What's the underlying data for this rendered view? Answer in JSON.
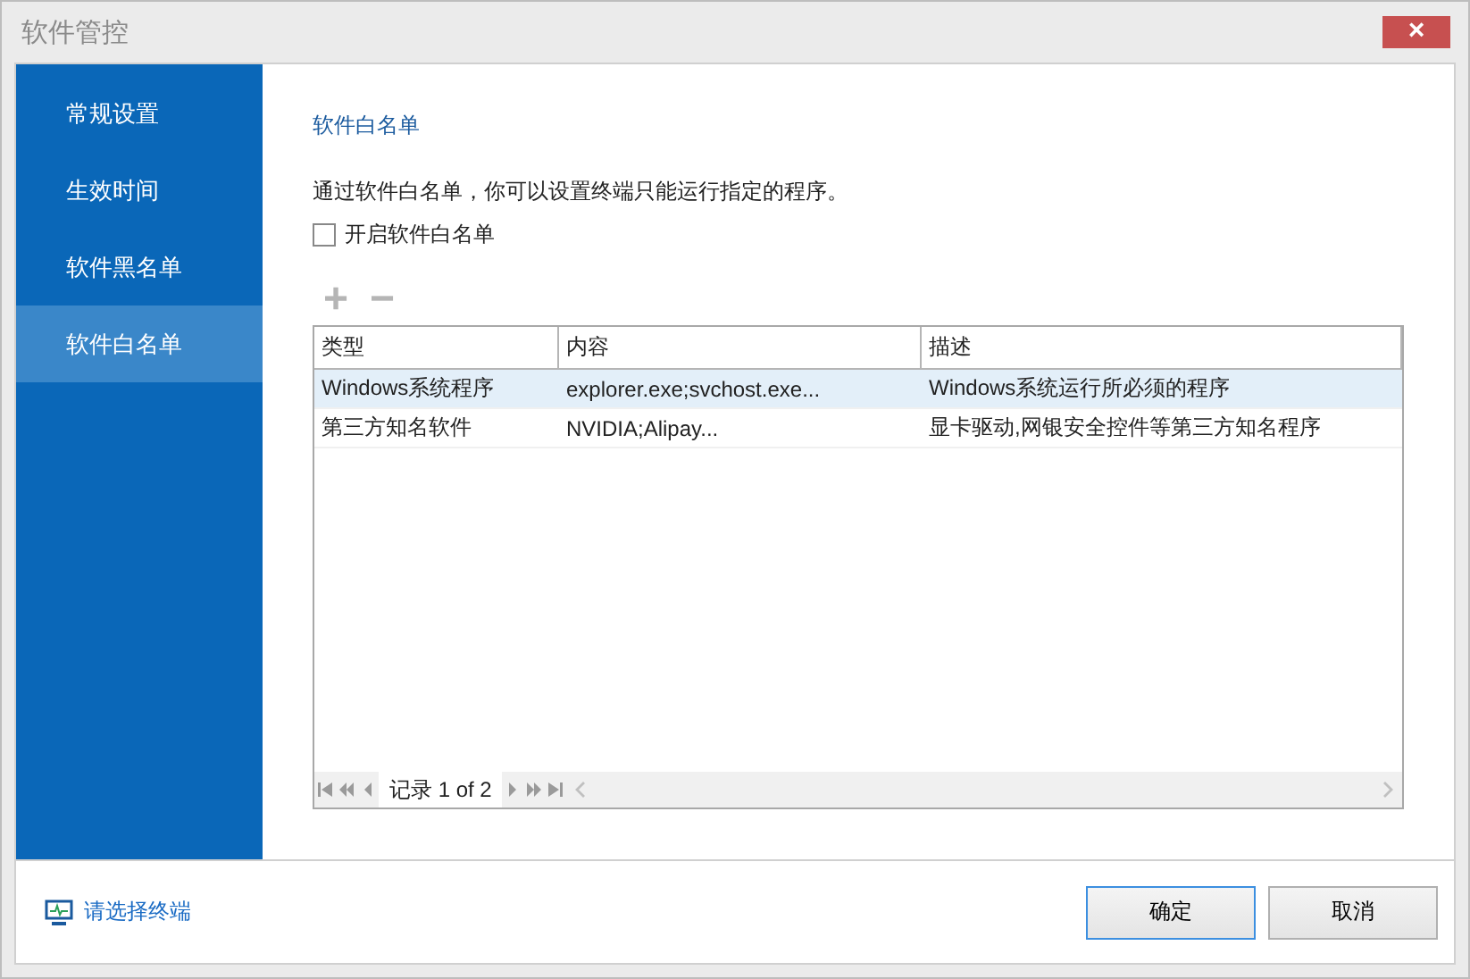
{
  "window": {
    "title": "软件管控",
    "close": "×"
  },
  "sidebar": {
    "items": [
      {
        "label": "常规设置",
        "selected": false
      },
      {
        "label": "生效时间",
        "selected": false
      },
      {
        "label": "软件黑名单",
        "selected": false
      },
      {
        "label": "软件白名单",
        "selected": true
      }
    ]
  },
  "section_title": "软件白名单",
  "description": "通过软件白名单，你可以设置终端只能运行指定的程序。",
  "enable_checkbox": {
    "label": "开启软件白名单",
    "checked": false
  },
  "toolbar": {
    "add": "+",
    "remove": "−"
  },
  "table": {
    "columns": [
      "类型",
      "内容",
      "描述"
    ],
    "rows": [
      {
        "cells": [
          "Windows系统程序",
          "explorer.exe;svchost.exe...",
          "Windows系统运行所必须的程序"
        ],
        "selected": true
      },
      {
        "cells": [
          "第三方知名软件",
          "NVIDIA;Alipay...",
          "显卡驱动,网银安全控件等第三方知名程序"
        ],
        "selected": false
      }
    ]
  },
  "pager": {
    "label": "记录 1 of 2"
  },
  "footer": {
    "terminal_link": "请选择终端",
    "buttons": [
      {
        "label": "确定",
        "focused": true
      },
      {
        "label": "取消",
        "focused": false
      }
    ]
  }
}
